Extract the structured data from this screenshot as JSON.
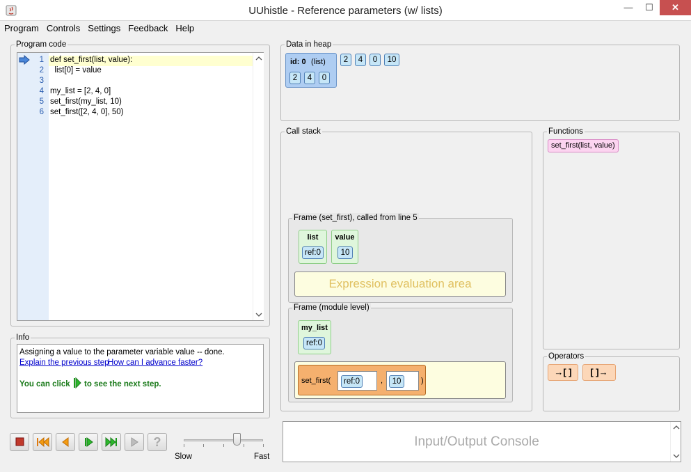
{
  "window": {
    "title": "UUhistle - Reference parameters (w/ lists)",
    "minimize": "—",
    "maximize": "☐",
    "close": "✕"
  },
  "menu": [
    "Program",
    "Controls",
    "Settings",
    "Feedback",
    "Help"
  ],
  "program_code": {
    "label": "Program code",
    "lines": [
      {
        "no": "1",
        "text": "def set_first(list, value):"
      },
      {
        "no": "2",
        "text": "  list[0] = value"
      },
      {
        "no": "3",
        "text": ""
      },
      {
        "no": "4",
        "text": "my_list = [2, 4, 0]"
      },
      {
        "no": "5",
        "text": "set_first(my_list, 10)"
      },
      {
        "no": "6",
        "text": "set_first([2, 4, 0], 50)"
      }
    ],
    "current_line": 1
  },
  "info": {
    "label": "Info",
    "message": "Assigning a value to the parameter variable value -- done.",
    "link_previous": "Explain the previous step",
    "link_faster": "How can I advance faster?",
    "hint_prefix": "You can click",
    "hint_suffix": "to see the next step."
  },
  "controls": {
    "speed_slow": "Slow",
    "speed_fast": "Fast",
    "speed_level": 0.66,
    "help_glyph": "?"
  },
  "heap": {
    "label": "Data in heap",
    "list_header_id": "id: 0",
    "list_header_type": "(list)",
    "list_values": [
      "2",
      "4",
      "0"
    ],
    "loose_values": [
      "2",
      "4",
      "0",
      "10"
    ]
  },
  "call_stack": {
    "label": "Call stack",
    "frame_fn": {
      "label": "Frame (set_first), called from line 5",
      "vars": [
        {
          "name": "list",
          "value": "ref:0"
        },
        {
          "name": "value",
          "value": "10"
        }
      ],
      "eval_area": "Expression evaluation area"
    },
    "frame_module": {
      "label": "Frame (module level)",
      "vars": [
        {
          "name": "my_list",
          "value": "ref:0"
        }
      ],
      "call_expr": {
        "prefix": "set_first(",
        "arg1": "ref:0",
        "sep": ",",
        "arg2": "10",
        "suffix": ")"
      }
    }
  },
  "functions": {
    "label": "Functions",
    "items": [
      "set_first(list, value)"
    ]
  },
  "operators": {
    "label": "Operators",
    "items": [
      "→[ ]",
      "[ ]→"
    ]
  },
  "console": {
    "label": "Input/Output Console"
  },
  "colors": {
    "accent_green": "#1a7a1a",
    "code_gutter": "#e4eefa",
    "eval_text": "#e0c060"
  }
}
